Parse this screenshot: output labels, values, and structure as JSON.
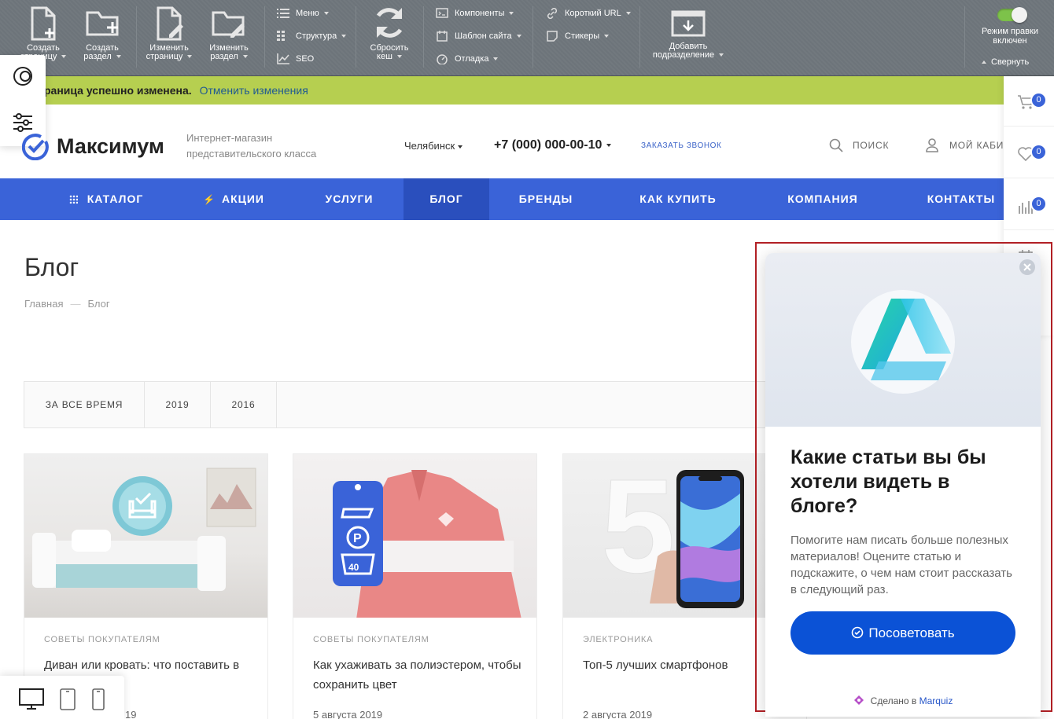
{
  "admin_bar": {
    "create_page": "Создать страницу",
    "create_section": "Создать раздел",
    "edit_page": "Изменить страницу",
    "edit_section": "Изменить раздел",
    "menu": "Меню",
    "structure": "Структура",
    "seo": "SEO",
    "reset_cache": "Сбросить кеш",
    "components": "Компоненты",
    "site_template": "Шаблон сайта",
    "debug": "Отладка",
    "short_url": "Короткий URL",
    "stickers": "Стикеры",
    "add_subsection": "Добавить подразделение",
    "edit_mode": "Режим правки включен",
    "collapse": "Свернуть"
  },
  "notice": {
    "message": "раница успешно изменена.",
    "undo": "Отменить изменения"
  },
  "header": {
    "logo": "Максимум",
    "tagline": "Интернет-магазин представительского класса",
    "city": "Челябинск",
    "phone": "+7 (000) 000-00-10",
    "callback": "ЗАКАЗАТЬ ЗВОНОК",
    "search": "ПОИСК",
    "account": "МОЙ КАБИН"
  },
  "nav": {
    "items": [
      {
        "label": "КАТАЛОГ"
      },
      {
        "label": "АКЦИИ"
      },
      {
        "label": "УСЛУГИ"
      },
      {
        "label": "БЛОГ"
      },
      {
        "label": "БРЕНДЫ"
      },
      {
        "label": "КАК КУПИТЬ"
      },
      {
        "label": "КОМПАНИЯ"
      },
      {
        "label": "КОНТАКТЫ"
      }
    ],
    "active": "БЛОГ"
  },
  "rail": {
    "cart_count": "0",
    "favorites_count": "0",
    "compare_count": "0"
  },
  "page": {
    "title": "Блог",
    "breadcrumb_home": "Главная",
    "breadcrumb_current": "Блог"
  },
  "filters": [
    {
      "label": "ЗА ВСЕ ВРЕМЯ"
    },
    {
      "label": "2019"
    },
    {
      "label": "2016"
    }
  ],
  "cards": [
    {
      "category": "СОВЕТЫ ПОКУПАТЕЛЯМ",
      "title": "Диван или кровать: что поставить в",
      "date": "19"
    },
    {
      "category": "СОВЕТЫ ПОКУПАТЕЛЯМ",
      "title": "Как ухаживать за полиэстером, чтобы сохранить цвет",
      "date": "5 августа 2019"
    },
    {
      "category": "ЭЛЕКТРОНИКА",
      "title": "Топ-5 лучших смартфонов",
      "date": "2 августа 2019"
    }
  ],
  "popup": {
    "title": "Какие статьи вы бы хотели видеть в блоге?",
    "text": "Помогите нам писать больше полезных материалов! Оцените статью и подскажите, о чем нам стоит рассказать в следующий раз.",
    "button": "Посоветовать",
    "made_in": "Сделано в",
    "brand": "Marquiz"
  },
  "colors": {
    "brand_blue": "#3a63d8",
    "nav_active": "#2a4fbd",
    "notice_green": "#b6cf50",
    "popup_button": "#0b52d6",
    "highlight_frame": "#b22025"
  }
}
